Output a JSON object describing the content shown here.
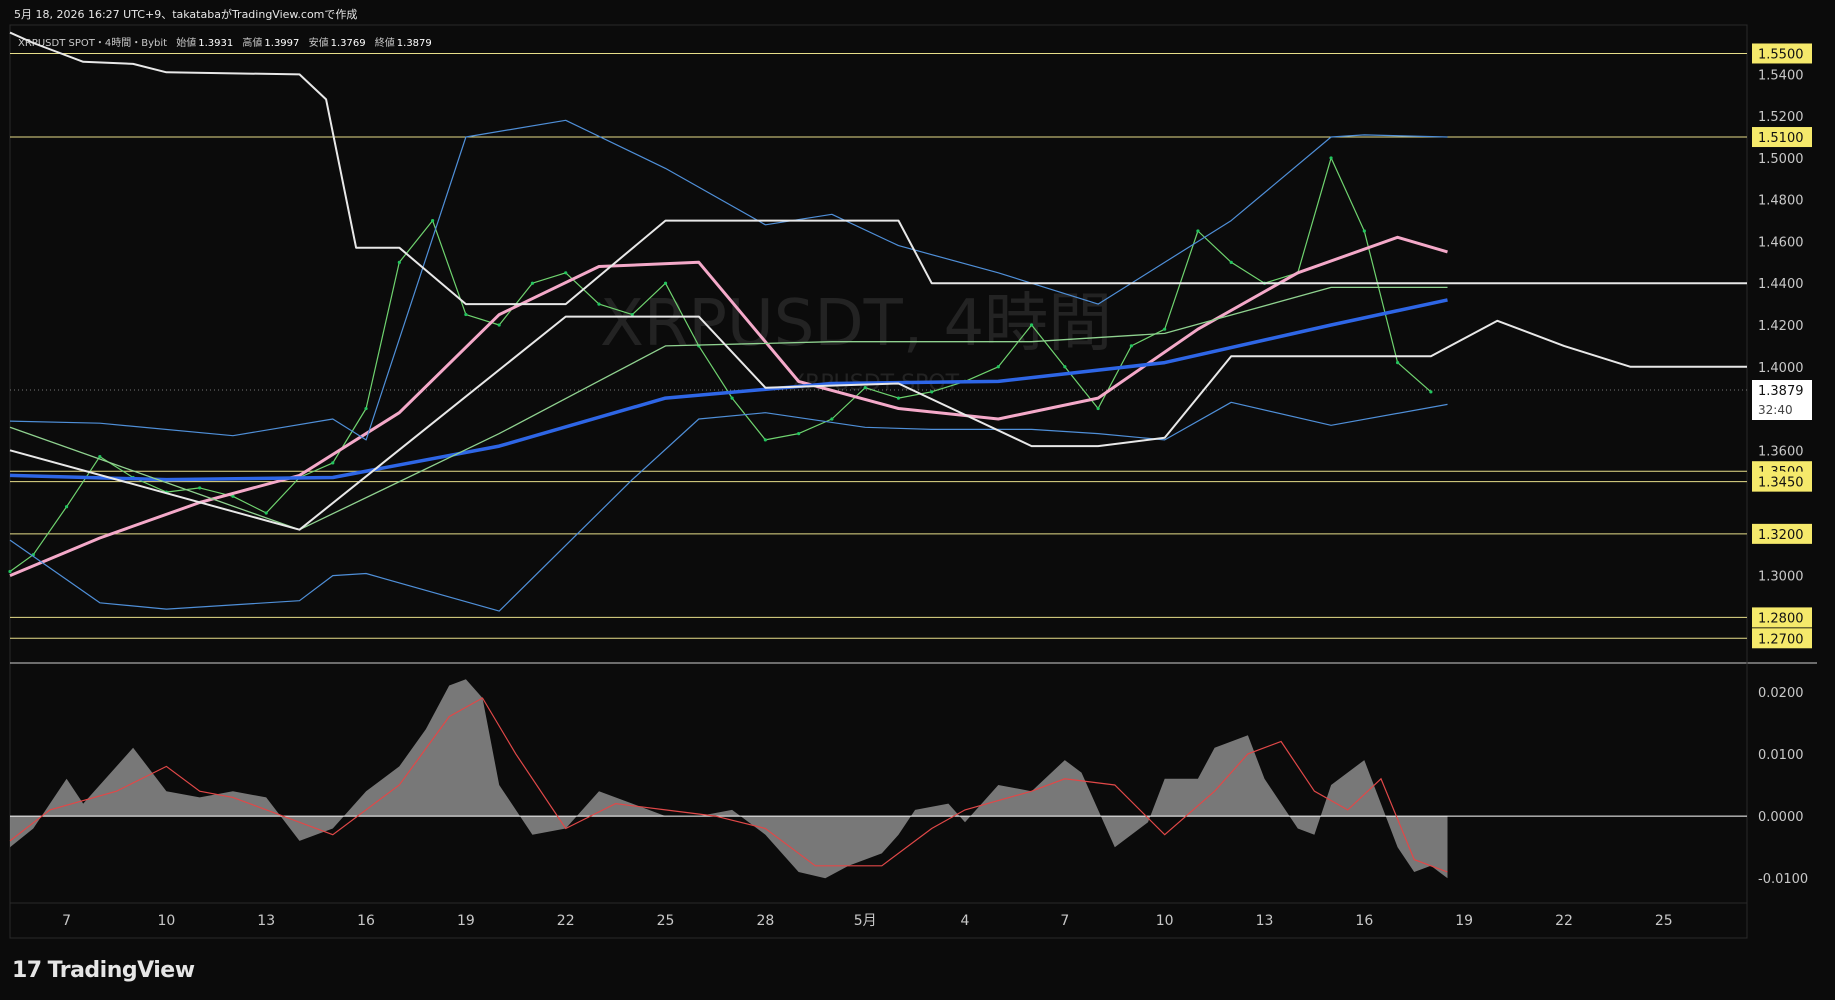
{
  "header": {
    "caption": "5月 18, 2026 16:27 UTC+9、takatabaがTradingView.comで作成"
  },
  "legend": {
    "symbol_line": "XRPUSDT SPOT・4時間・Bybit",
    "open_label": "始値",
    "open": "1.3931",
    "high_label": "高値",
    "high": "1.3997",
    "low_label": "安値",
    "low": "1.3769",
    "close_label": "終値",
    "close": "1.3879"
  },
  "watermark": {
    "main": "XRPUSDT, 4時間",
    "sub": "XRPUSDT SPOT"
  },
  "current_price": {
    "price": "1.3879",
    "countdown": "32:40"
  },
  "footer": {
    "brand": "TradingView"
  },
  "colors": {
    "background": "#0b0b0b",
    "up_candle": "#22c55e",
    "down_candle": "#ffffff",
    "ma_short": "#d86bd8",
    "ma_mid": "#f4a9c9",
    "ma_long": "#2e66e6",
    "ma_green": "#8fd18f",
    "bollinger": "#4f8fd8",
    "envelope": "#e8e8e8",
    "hline": "#e7de8a",
    "osc_fill": "#8c8c8c",
    "osc_signal": "#e04848"
  },
  "chart_data": [
    {
      "type": "line",
      "title": "XRPUSDT SPOT 4H",
      "y_axis_ticks": [
        "1.5400",
        "1.5200",
        "1.5000",
        "1.4800",
        "1.4600",
        "1.4400",
        "1.4200",
        "1.4000",
        "1.3600",
        "1.3000"
      ],
      "y_axis_tick_values": [
        1.54,
        1.52,
        1.5,
        1.48,
        1.46,
        1.44,
        1.42,
        1.4,
        1.36,
        1.3
      ],
      "x_axis_labels": [
        "7",
        "10",
        "13",
        "16",
        "19",
        "22",
        "25",
        "28",
        "5月",
        "4",
        "7",
        "10",
        "13",
        "16",
        "19",
        "22",
        "25"
      ],
      "x_axis_label_days": [
        7,
        10,
        13,
        16,
        19,
        22,
        25,
        28,
        31,
        34,
        37,
        40,
        43,
        46,
        49,
        52,
        55
      ],
      "ylim": [
        1.262,
        1.5555
      ],
      "xlim": [
        5.3,
        57.5
      ],
      "horizontal_levels": [
        "1.5500",
        "1.5100",
        "1.3500",
        "1.3450",
        "1.3200",
        "1.2800",
        "1.2700"
      ],
      "horizontal_level_values": [
        1.55,
        1.51,
        1.35,
        1.345,
        1.32,
        1.28,
        1.27
      ],
      "series": [
        {
          "name": "",
          "x": [
            5.3,
            6.0,
            7.0,
            8.0,
            9.0,
            10.0,
            11.0,
            12.0,
            13.0,
            14.0,
            15.0,
            16.0,
            17.0,
            18.0,
            19.0,
            20.0,
            21.0,
            22.0,
            23.0,
            24.0,
            25.0,
            26.0,
            27.0,
            28.0,
            29.0,
            30.0,
            31.0,
            32.0,
            33.0,
            34.0,
            35.0,
            36.0,
            37.0,
            38.0,
            39.0,
            40.0,
            41.0,
            42.0,
            43.0,
            44.0,
            45.0,
            46.0,
            47.0,
            48.0
          ],
          "values": [
            1.302,
            1.31,
            1.333,
            1.357,
            1.347,
            1.34,
            1.342,
            1.338,
            1.33,
            1.347,
            1.354,
            1.38,
            1.45,
            1.47,
            1.425,
            1.42,
            1.44,
            1.445,
            1.43,
            1.425,
            1.44,
            1.41,
            1.385,
            1.365,
            1.368,
            1.375,
            1.39,
            1.385,
            1.388,
            1.393,
            1.4,
            1.42,
            1.4,
            1.38,
            1.41,
            1.418,
            1.465,
            1.45,
            1.44,
            1.445,
            1.5,
            1.465,
            1.402,
            1.388
          ]
        },
        {
          "name": "",
          "x": [
            5.3,
            8,
            11,
            14,
            17,
            20,
            23,
            26,
            29,
            32,
            35,
            38,
            41,
            44,
            47,
            48.5
          ],
          "values": [
            1.3,
            1.318,
            1.335,
            1.348,
            1.378,
            1.425,
            1.448,
            1.45,
            1.393,
            1.38,
            1.375,
            1.385,
            1.418,
            1.445,
            1.462,
            1.455
          ]
        },
        {
          "name": "",
          "x": [
            5.3,
            10,
            15,
            20,
            25,
            30,
            35,
            40,
            45,
            48.5
          ],
          "values": [
            1.348,
            1.346,
            1.347,
            1.362,
            1.385,
            1.392,
            1.393,
            1.402,
            1.42,
            1.432
          ]
        },
        {
          "name": "",
          "x": [
            5.3,
            14,
            20,
            25,
            30,
            36,
            40,
            45,
            48.5
          ],
          "values": [
            1.371,
            1.322,
            1.368,
            1.41,
            1.412,
            1.412,
            1.416,
            1.438,
            1.438
          ]
        },
        {
          "name": "",
          "x": [
            5.3,
            8,
            10,
            14,
            15,
            16,
            20,
            24,
            26,
            28,
            31,
            33,
            36,
            38,
            40,
            42,
            45,
            48.5
          ],
          "values": [
            1.317,
            1.287,
            1.284,
            1.288,
            1.3,
            1.301,
            1.283,
            1.346,
            1.375,
            1.378,
            1.371,
            1.37,
            1.37,
            1.368,
            1.365,
            1.383,
            1.372,
            1.382
          ]
        },
        {
          "name": "",
          "x": [
            5.3,
            8,
            12,
            15,
            16,
            19,
            22,
            25,
            28,
            30,
            32,
            35,
            38,
            42,
            45,
            46,
            48.5
          ],
          "values": [
            1.374,
            1.373,
            1.367,
            1.375,
            1.365,
            1.51,
            1.518,
            1.495,
            1.468,
            1.473,
            1.458,
            1.445,
            1.43,
            1.47,
            1.51,
            1.511,
            1.51
          ]
        },
        {
          "name": "",
          "x": [
            5.3,
            6,
            7.5,
            9,
            10,
            14,
            14.8,
            15.7,
            17,
            19,
            22,
            25,
            28,
            30,
            32,
            33,
            37,
            39,
            40,
            41,
            42,
            48,
            49,
            52,
            54,
            57.5
          ],
          "values": [
            1.56,
            1.555,
            1.546,
            1.545,
            1.541,
            1.54,
            1.528,
            1.457,
            1.457,
            1.43,
            1.43,
            1.47,
            1.47,
            1.47,
            1.47,
            1.44,
            1.44,
            1.44,
            1.44,
            1.44,
            1.44,
            1.44,
            1.44,
            1.44,
            1.44,
            1.44
          ]
        },
        {
          "name": "",
          "x": [
            5.3,
            14,
            22,
            26,
            28,
            32,
            36,
            38,
            40,
            42,
            46,
            48,
            50,
            52,
            54,
            56,
            57.5
          ],
          "values": [
            1.36,
            1.322,
            1.424,
            1.424,
            1.39,
            1.392,
            1.362,
            1.362,
            1.366,
            1.405,
            1.405,
            1.405,
            1.422,
            1.41,
            1.4,
            1.4,
            1.4
          ]
        }
      ]
    },
    {
      "type": "area",
      "title": "",
      "y_axis_ticks": [
        "0.0200",
        "0.0100",
        "0.0000",
        "-0.0100"
      ],
      "y_axis_tick_values": [
        0.02,
        0.01,
        0.0,
        -0.01
      ],
      "ylim": [
        -0.0135,
        0.0235
      ],
      "series": [
        {
          "name": "",
          "x": [
            5.3,
            6.0,
            7.0,
            7.5,
            8.5,
            9.0,
            10.0,
            11.0,
            12.0,
            13.0,
            14.0,
            15.0,
            16.0,
            17.0,
            17.8,
            18.5,
            19.0,
            19.5,
            20.0,
            21.0,
            22.0,
            23.0,
            24.0,
            25.0,
            26.0,
            27.0,
            28.0,
            29.0,
            29.8,
            30.5,
            31.5,
            32.0,
            32.5,
            33.5,
            34.0,
            35.0,
            36.0,
            37.0,
            37.5,
            38.5,
            39.5,
            40.0,
            41.0,
            41.5,
            42.5,
            43.0,
            44.0,
            44.5,
            45.0,
            46.0,
            47.0,
            47.5,
            48.0,
            48.5
          ],
          "values": [
            -0.005,
            -0.002,
            0.006,
            0.002,
            0.008,
            0.011,
            0.004,
            0.003,
            0.004,
            0.003,
            -0.004,
            -0.002,
            0.004,
            0.008,
            0.014,
            0.021,
            0.022,
            0.019,
            0.005,
            -0.003,
            -0.002,
            0.004,
            0.002,
            0.0,
            0.0,
            0.001,
            -0.003,
            -0.009,
            -0.01,
            -0.008,
            -0.006,
            -0.003,
            0.001,
            0.002,
            -0.001,
            0.005,
            0.004,
            0.009,
            0.007,
            -0.005,
            -0.001,
            0.006,
            0.006,
            0.011,
            0.013,
            0.006,
            -0.002,
            -0.003,
            0.005,
            0.009,
            -0.005,
            -0.009,
            -0.008,
            -0.01
          ]
        },
        {
          "name": "",
          "x": [
            5.3,
            6.5,
            8.5,
            10,
            11,
            12,
            13.5,
            15,
            17,
            18.5,
            19.5,
            20.5,
            22,
            23.5,
            25,
            26.5,
            28,
            29.5,
            31.5,
            33,
            34,
            36,
            37,
            38.5,
            40,
            41.5,
            42.5,
            43.5,
            44.5,
            45.5,
            46.5,
            47.5,
            48.5
          ],
          "values": [
            -0.004,
            0.001,
            0.004,
            0.008,
            0.004,
            0.003,
            0.0,
            -0.003,
            0.005,
            0.016,
            0.019,
            0.01,
            -0.002,
            0.002,
            0.001,
            0.0,
            -0.002,
            -0.008,
            -0.008,
            -0.002,
            0.001,
            0.004,
            0.006,
            0.005,
            -0.003,
            0.004,
            0.01,
            0.012,
            0.004,
            0.001,
            0.006,
            -0.007,
            -0.009
          ]
        }
      ]
    }
  ]
}
